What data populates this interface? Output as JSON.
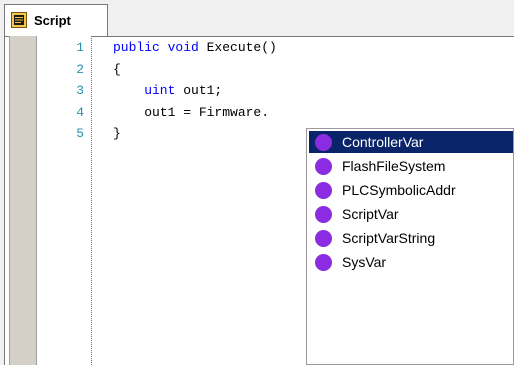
{
  "tab": {
    "label": "Script",
    "icon": "script-document-icon"
  },
  "editor": {
    "lines": [
      {
        "number": "1",
        "parts": [
          {
            "text": "public void ",
            "kind": "kw"
          },
          {
            "text": "Execute()",
            "kind": "tk"
          }
        ]
      },
      {
        "number": "2",
        "parts": [
          {
            "text": "{",
            "kind": "tk"
          }
        ]
      },
      {
        "number": "3",
        "parts": [
          {
            "text": "    uint ",
            "kind": "kw"
          },
          {
            "text": "out1;",
            "kind": "tk"
          }
        ]
      },
      {
        "number": "4",
        "parts": [
          {
            "text": "    out1 = Firmware.",
            "kind": "tk"
          }
        ]
      },
      {
        "number": "5",
        "parts": [
          {
            "text": "}",
            "kind": "tk"
          }
        ]
      }
    ]
  },
  "autocomplete": {
    "selected_index": 0,
    "item_icon": "member-dot-icon",
    "items": [
      {
        "label": "ControllerVar"
      },
      {
        "label": "FlashFileSystem"
      },
      {
        "label": "PLCSymbolicAddr"
      },
      {
        "label": "ScriptVar"
      },
      {
        "label": "ScriptVarString"
      },
      {
        "label": "SysVar"
      }
    ]
  },
  "colors": {
    "keyword": "#0000ff",
    "line_number": "#2b91af",
    "selection": "#0a246a",
    "member_dot": "#8b2be2"
  }
}
